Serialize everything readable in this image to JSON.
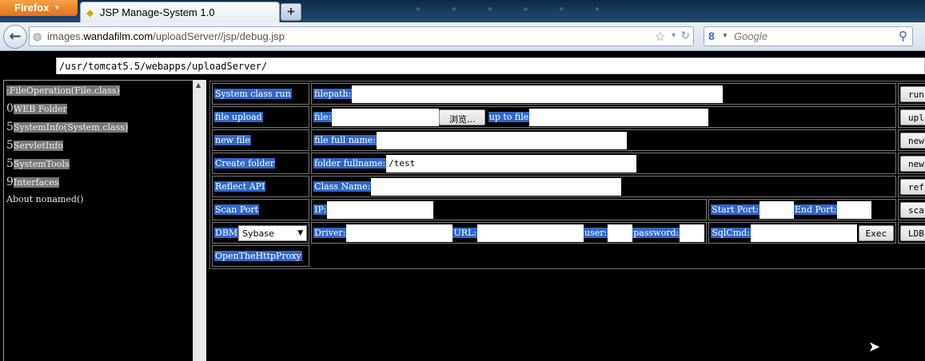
{
  "browser": {
    "menu_label": "Firefox",
    "tab_title": "JSP Manage-System 1.0",
    "new_tab": "+",
    "url_prefix": "images.",
    "url_domain": "wandafilm.com",
    "url_path": "/uploadServer//jsp/debug.jsp",
    "search_placeholder": "Google",
    "blurred_tray": "● ● ● ● ● ●"
  },
  "path": "/usr/tomcat5.5/webapps/uploadServer/",
  "left_nav": [
    {
      "prefix": "",
      "label": ":FileOperation(File.class)",
      "selected": true
    },
    {
      "prefix": "0",
      "label": "WEB Folder",
      "selected": true
    },
    {
      "prefix": "5",
      "label": "SystemInfo(System.class)",
      "selected": true
    },
    {
      "prefix": "5",
      "label": "ServletInfo",
      "selected": true
    },
    {
      "prefix": "5",
      "label": "SystemTools",
      "selected": true
    },
    {
      "prefix": "9",
      "label": "Interfaces",
      "selected": true
    },
    {
      "prefix": "",
      "label": "About nonamed()",
      "selected": false
    }
  ],
  "rows": {
    "run": {
      "label": "System class run",
      "field": "filepath:",
      "button": "run"
    },
    "upload": {
      "label": "file upload",
      "field": "file:",
      "browse": "浏览...",
      "field2": "up to file",
      "button": "upl"
    },
    "newfile": {
      "label": "new file",
      "field": "file full name:",
      "button": "new"
    },
    "folder": {
      "label": "Create folder",
      "field": "folder fullname:",
      "value": "/test",
      "button": "new"
    },
    "reflect": {
      "label": "Reflect API",
      "field": "Class Name:",
      "button": "ref"
    },
    "scan": {
      "label": "Scan Port",
      "field": "IP:",
      "start": "Start Port:",
      "end": "End Port:",
      "button": "sca"
    },
    "db": {
      "label": "DBM",
      "select": "Sybase",
      "driver": "Driver:",
      "url": "URL:",
      "user": "user:",
      "password": "password:",
      "sqlcmd": "SqlCmd:",
      "exec": "Exec",
      "button": "LDB"
    },
    "proxy": {
      "label": "OpenTheHttpProxy"
    }
  }
}
